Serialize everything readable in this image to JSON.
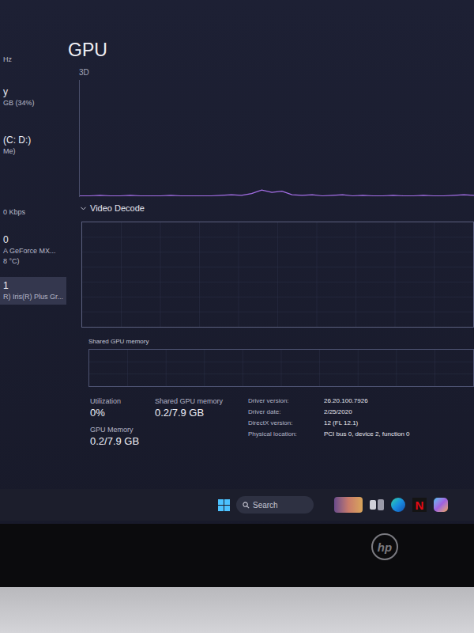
{
  "sidebar": {
    "items": [
      {
        "lines": [
          {
            "text": "Hz",
            "kind": "detail"
          }
        ],
        "selected": false
      },
      {
        "lines": [
          {
            "text": "y",
            "kind": "title"
          },
          {
            "text": "GB (34%)",
            "kind": "detail"
          }
        ],
        "selected": false
      },
      {
        "lines": [
          {
            "text": "(C: D:)",
            "kind": "title"
          },
          {
            "text": "Me)",
            "kind": "detail"
          }
        ],
        "selected": false
      },
      {
        "lines": [
          {
            "text": "0 Kbps",
            "kind": "detail"
          }
        ],
        "selected": false
      },
      {
        "lines": [
          {
            "text": "0",
            "kind": "title"
          },
          {
            "text": "A GeForce MX...",
            "kind": "detail"
          },
          {
            "text": "8 °C)",
            "kind": "detail"
          }
        ],
        "selected": false
      },
      {
        "lines": [
          {
            "text": "1",
            "kind": "title"
          },
          {
            "text": "R) Iris(R) Plus Gr...",
            "kind": "detail"
          }
        ],
        "selected": true
      }
    ]
  },
  "title": "GPU",
  "charts": {
    "three_d": {
      "label": "3D",
      "values": [
        1,
        1,
        1.5,
        1,
        1,
        1.5,
        1,
        1,
        1,
        1.5,
        1,
        1,
        1,
        1,
        1.5,
        2,
        1.5,
        3,
        6,
        4,
        5,
        2,
        1.5,
        2,
        1,
        1.5,
        2,
        1,
        1.5,
        1,
        1,
        1.5,
        1,
        1,
        1.5,
        1,
        1,
        1.5,
        2,
        1.5
      ]
    },
    "video_decode": {
      "label": "Video Decode",
      "expanded": true
    },
    "shared": {
      "label": "Shared GPU memory"
    }
  },
  "stats": [
    {
      "label": "Utilization",
      "value": "0%"
    },
    {
      "label": "Shared GPU memory",
      "value": "0.2/7.9 GB"
    },
    {
      "label": "GPU Memory",
      "value": "0.2/7.9 GB"
    }
  ],
  "details": [
    {
      "label": "Driver version:",
      "value": "26.20.100.7926"
    },
    {
      "label": "Driver date:",
      "value": "2/25/2020"
    },
    {
      "label": "DirectX version:",
      "value": "12 (FL 12.1)"
    },
    {
      "label": "Physical location:",
      "value": "PCI bus 0, device 2, function 0"
    }
  ],
  "taskbar": {
    "search": {
      "placeholder": "Search"
    },
    "apps": [
      {
        "kind": "widgets"
      },
      {
        "kind": "task-view"
      },
      {
        "kind": "edge"
      },
      {
        "kind": "netflix",
        "label": "N"
      },
      {
        "kind": "copilot"
      }
    ]
  },
  "laptop": {
    "logo": "hp"
  }
}
